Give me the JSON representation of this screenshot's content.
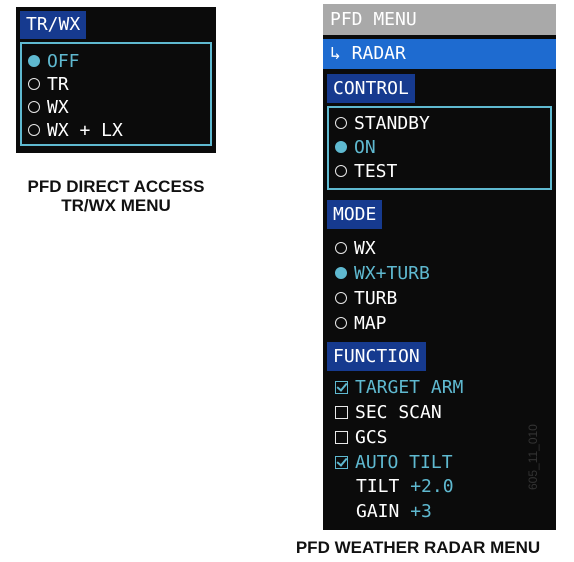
{
  "direct_menu": {
    "header": "TR/WX",
    "options": [
      {
        "label": "OFF",
        "selected": true
      },
      {
        "label": "TR",
        "selected": false
      },
      {
        "label": "WX",
        "selected": false
      },
      {
        "label": "WX + LX",
        "selected": false
      }
    ],
    "caption_line1": "PFD DIRECT ACCESS",
    "caption_line2": "TR/WX MENU"
  },
  "radar_menu": {
    "title": "PFD MENU",
    "current": "↳ RADAR",
    "control": {
      "header": "CONTROL",
      "options": [
        {
          "label": "STANDBY",
          "selected": false
        },
        {
          "label": "ON",
          "selected": true
        },
        {
          "label": "TEST",
          "selected": false
        }
      ]
    },
    "mode": {
      "header": "MODE",
      "options": [
        {
          "label": "WX",
          "selected": false
        },
        {
          "label": "WX+TURB",
          "selected": true
        },
        {
          "label": "TURB",
          "selected": false
        },
        {
          "label": "MAP",
          "selected": false
        }
      ]
    },
    "function": {
      "header": "FUNCTION",
      "checks": [
        {
          "label": "TARGET ARM",
          "checked": true
        },
        {
          "label": "SEC SCAN",
          "checked": false
        },
        {
          "label": "GCS",
          "checked": false
        },
        {
          "label": "AUTO TILT",
          "checked": true
        }
      ],
      "tilt_label": "TILT",
      "tilt_value": "+2.0",
      "gain_label": "GAIN",
      "gain_value": "+3"
    },
    "caption": "PFD WEATHER RADAR MENU"
  },
  "figure_id": "605_11_010",
  "colors": {
    "panel_bg": "#0b0b0b",
    "header_bg": "#163a8f",
    "accent_cyan": "#5fb9d0",
    "title_gray": "#a9a9a9",
    "selection_blue": "#1e6bd0"
  }
}
